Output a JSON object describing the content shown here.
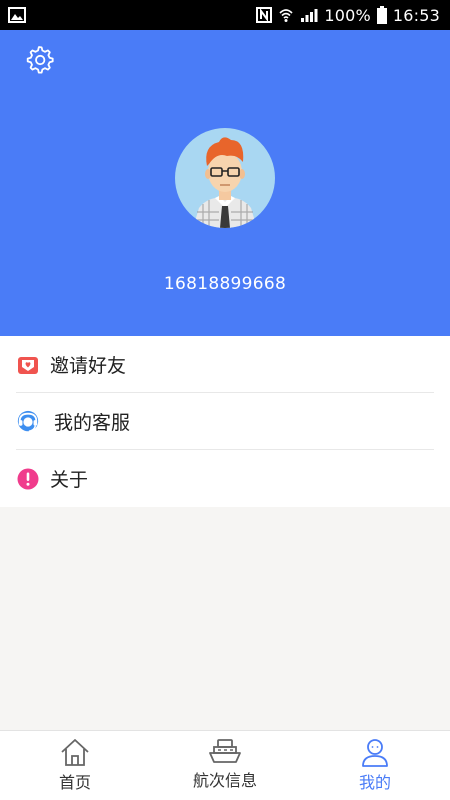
{
  "status_bar": {
    "battery_text": "100%",
    "time": "16:53"
  },
  "profile": {
    "phone": "16818899668"
  },
  "menu": {
    "items": [
      {
        "label": "邀请好友",
        "icon": "invite-envelope-icon"
      },
      {
        "label": "我的客服",
        "icon": "customer-service-icon"
      },
      {
        "label": "关于",
        "icon": "about-exclamation-icon"
      }
    ]
  },
  "bottom_nav": {
    "items": [
      {
        "label": "首页",
        "icon": "home-icon"
      },
      {
        "label": "航次信息",
        "icon": "ship-icon"
      },
      {
        "label": "我的",
        "icon": "user-icon",
        "active": true
      }
    ]
  },
  "colors": {
    "header_bg": "#4a7cf7",
    "accent": "#4a7cf7",
    "invite_red": "#f0544f",
    "service_blue": "#3d8ef0",
    "about_pink": "#f03c8c"
  }
}
